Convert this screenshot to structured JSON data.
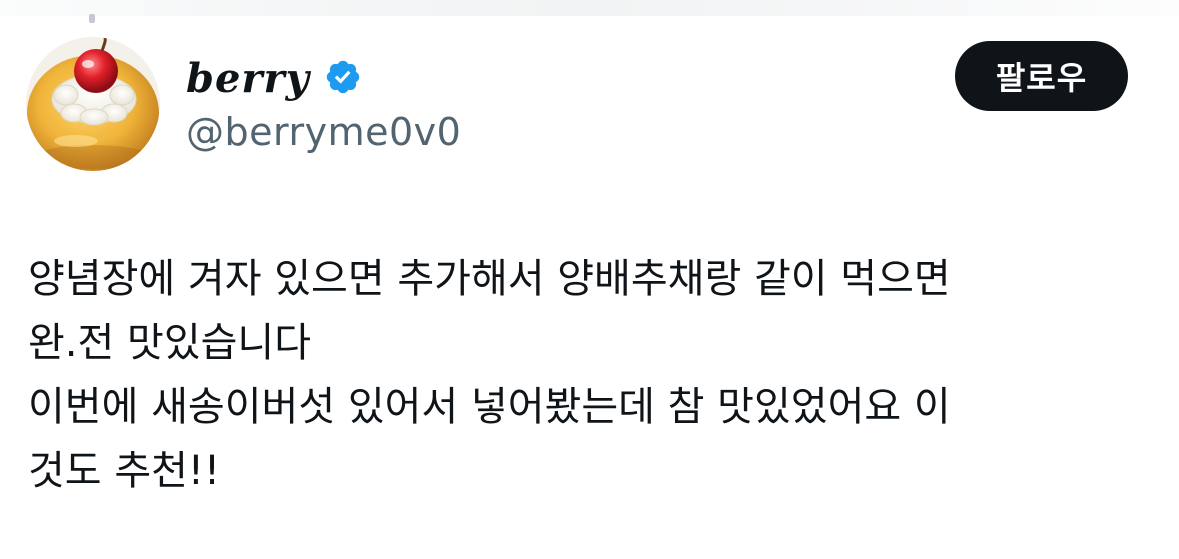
{
  "author": {
    "display_name": "berry",
    "handle": "@berryme0v0",
    "verified": true,
    "avatar_icon": "custard-pudding-cherry-avatar",
    "verified_icon": "verified-badge-icon"
  },
  "actions": {
    "follow_label": "팔로우"
  },
  "tweet": {
    "lines": [
      "양념장에 겨자 있으면 추가해서 양배추채랑 같이 먹으면",
      "완.전 맛있습니다",
      "이번에 새송이버섯 있어서 넣어봤는데 참 맛있었어요 이",
      "것도 추천!!"
    ]
  },
  "colors": {
    "text": "#0f1419",
    "secondary_text": "#536471",
    "follow_button_bg": "#0f1419",
    "follow_button_text": "#ffffff",
    "verified_blue": "#1d9bf0"
  }
}
